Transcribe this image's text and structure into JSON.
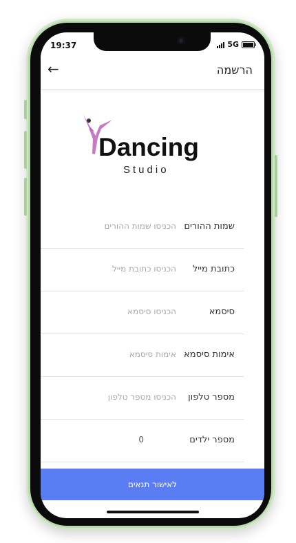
{
  "status_bar": {
    "time": "19:37",
    "network": "5G"
  },
  "header": {
    "title": "הרשמה"
  },
  "logo": {
    "word": "Dancing",
    "sub": "Studio"
  },
  "form": {
    "fields": [
      {
        "label": "שמות ההורים",
        "placeholder": "הכניסו שמות ההורים"
      },
      {
        "label": "כתובת מייל",
        "placeholder": "הכניסו כתובת מייל"
      },
      {
        "label": "סיסמא",
        "placeholder": "הכניסו סיסמא"
      },
      {
        "label": "אימות סיסמא",
        "placeholder": "אימות סיסמא"
      },
      {
        "label": "מספר טלפון",
        "placeholder": "הכניסו מספר טלפון"
      },
      {
        "label": "מספר ילדים",
        "value": "0"
      }
    ]
  },
  "cta": {
    "label": "לאישור תנאים"
  },
  "colors": {
    "accent": "#5b7df3",
    "logo_figure": "#c77ac4",
    "frame": "#cfe7c6"
  }
}
